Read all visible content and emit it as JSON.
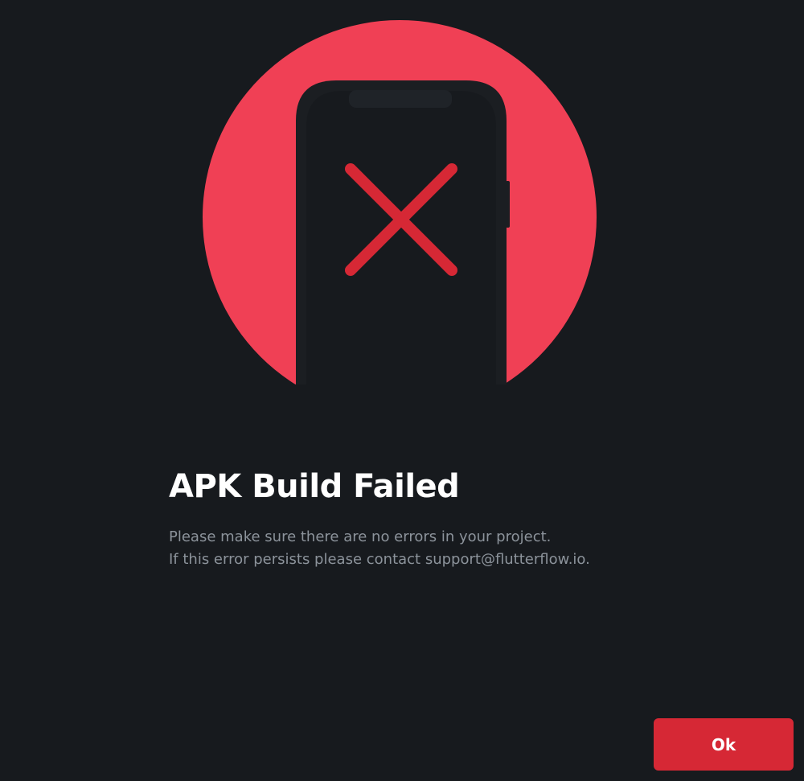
{
  "dialog": {
    "title": "APK Build Failed",
    "message_line_1": "Please make sure there are no errors in your project.",
    "message_line_2": "If this error persists please contact support@flutterflow.io.",
    "ok_label": "Ok"
  },
  "illustration": {
    "icon": "phone-error-icon",
    "circle_color": "#f04055",
    "phone_color": "#1b1e22",
    "cross_color": "#d62835"
  },
  "colors": {
    "background": "#171a1e",
    "title": "#ffffff",
    "message": "#8c939b",
    "accent": "#d62835"
  }
}
